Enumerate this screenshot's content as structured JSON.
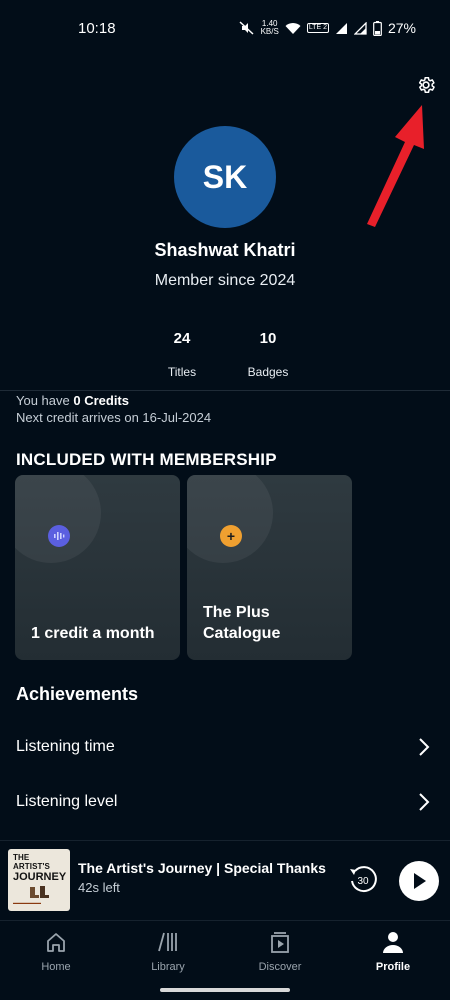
{
  "status_bar": {
    "time": "10:18",
    "net_speed": "1.40",
    "net_unit": "KB/S",
    "lte_label": "LTE 2",
    "battery": "27%"
  },
  "profile": {
    "initials": "SK",
    "name": "Shashwat Khatri",
    "member_since": "Member since 2024",
    "avatar_color": "#1a5a9c"
  },
  "stats": [
    {
      "value": "24",
      "label": "Titles"
    },
    {
      "value": "10",
      "label": "Badges"
    }
  ],
  "credits": {
    "prefix": "You have ",
    "amount": "0 Credits",
    "next": "Next credit arrives on 16-Jul-2024"
  },
  "membership": {
    "title": "INCLUDED WITH MEMBERSHIP",
    "cards": [
      {
        "label": "1 credit a month",
        "icon": "waveform-icon",
        "icon_color": "#5b5fe0"
      },
      {
        "label": "The Plus Catalogue",
        "icon": "plus-icon",
        "icon_color": "#f0a030"
      }
    ]
  },
  "achievements": {
    "title": "Achievements",
    "rows": [
      {
        "label": "Listening time"
      },
      {
        "label": "Listening level"
      }
    ]
  },
  "mini_player": {
    "title": "The Artist's Journey | Special Thanks",
    "remaining": "42s left",
    "cover_line1": "THE ARTIST'S",
    "cover_line2": "JOURNEY",
    "rewind_label": "30"
  },
  "nav": [
    {
      "label": "Home",
      "icon": "home-icon",
      "active": false
    },
    {
      "label": "Library",
      "icon": "library-icon",
      "active": false
    },
    {
      "label": "Discover",
      "icon": "discover-icon",
      "active": false
    },
    {
      "label": "Profile",
      "icon": "profile-icon",
      "active": true
    }
  ],
  "colors": {
    "background": "#020d18",
    "card": "#2a353b",
    "annotation_arrow": "#e8202a"
  }
}
